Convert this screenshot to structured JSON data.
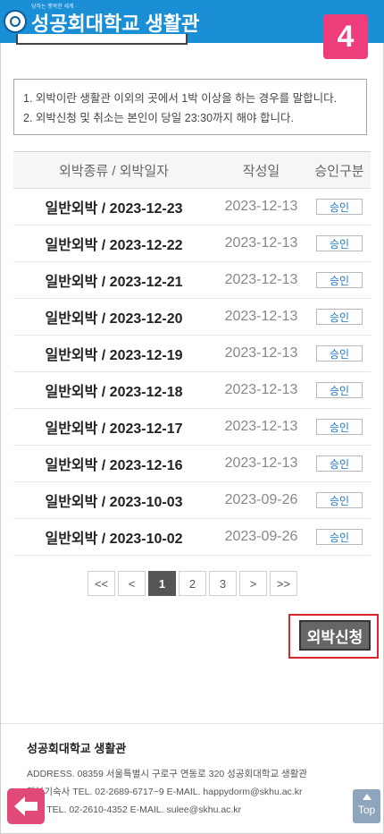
{
  "header": {
    "logo_small": "당하는 행복한 세계 ·",
    "logo_text": "성공회대학교 생활관"
  },
  "step_badge": "4",
  "notice": [
    "1. 외박이란 생활관 이외의 곳에서 1박 이상을 하는 경우를 말합니다.",
    "2. 외박신청 및 취소는 본인이 당일 23:30까지 해야 합니다."
  ],
  "table": {
    "headers": [
      "외박종류 / 외박일자",
      "작성일",
      "승인구분"
    ],
    "rows": [
      {
        "title": "일반외박 / 2023-12-23",
        "date": "2023-12-13",
        "status": "승인"
      },
      {
        "title": "일반외박 / 2023-12-22",
        "date": "2023-12-13",
        "status": "승인"
      },
      {
        "title": "일반외박 / 2023-12-21",
        "date": "2023-12-13",
        "status": "승인"
      },
      {
        "title": "일반외박 / 2023-12-20",
        "date": "2023-12-13",
        "status": "승인"
      },
      {
        "title": "일반외박 / 2023-12-19",
        "date": "2023-12-13",
        "status": "승인"
      },
      {
        "title": "일반외박 / 2023-12-18",
        "date": "2023-12-13",
        "status": "승인"
      },
      {
        "title": "일반외박 / 2023-12-17",
        "date": "2023-12-13",
        "status": "승인"
      },
      {
        "title": "일반외박 / 2023-12-16",
        "date": "2023-12-13",
        "status": "승인"
      },
      {
        "title": "일반외박 / 2023-10-03",
        "date": "2023-09-26",
        "status": "승인"
      },
      {
        "title": "일반외박 / 2023-10-02",
        "date": "2023-09-26",
        "status": "승인"
      }
    ]
  },
  "pagination": {
    "first": "<<",
    "prev": "<",
    "pages": [
      "1",
      "2",
      "3"
    ],
    "current": "1",
    "next": ">",
    "last": ">>"
  },
  "apply_button": "외박신청",
  "footer": {
    "title": "성공회대학교 생활관",
    "address": "ADDRESS. 08359 서울특별시 구로구 연동로 320 성공회대학교 생활관",
    "line1": "행복기숙사   TEL. 02-2689-6717~9   E-MAIL. happydorm@skhu.ac.kr",
    "line2": "     엘관   TEL. 02-2610-4352   E-MAIL. sulee@skhu.ac.kr"
  },
  "top_button": "Top",
  "colors": {
    "header": "#1a8fd6",
    "badge": "#ee3d7a",
    "highlight": "#d9272e",
    "status": "#1b78c6"
  }
}
